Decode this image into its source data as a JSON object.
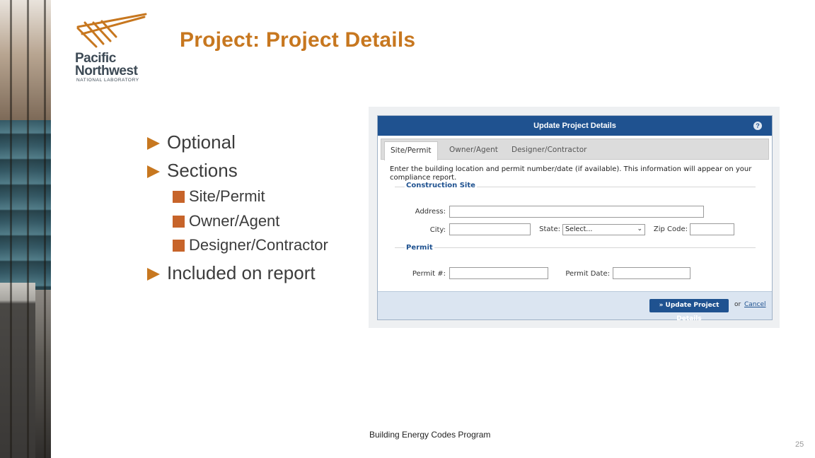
{
  "logo": {
    "line1": "Pacific",
    "line2": "Northwest",
    "line3": "NATIONAL LABORATORY"
  },
  "title": "Project: Project Details",
  "bullets": {
    "optional": "Optional",
    "sections": "Sections",
    "sub": [
      "Site/Permit",
      "Owner/Agent",
      "Designer/Contractor"
    ],
    "included": "Included on report"
  },
  "dialog": {
    "title": "Update Project Details",
    "help_icon": "?",
    "tabs": [
      "Site/Permit",
      "Owner/Agent",
      "Designer/Contractor"
    ],
    "intro": "Enter the building location and permit number/date (if available). This information will appear on your compliance report.",
    "construction_legend": "Construction Site",
    "address_label": "Address:",
    "city_label": "City:",
    "state_label": "State:",
    "state_value": "Select...",
    "zip_label": "Zip Code:",
    "permit_legend": "Permit",
    "permit_no_label": "Permit #:",
    "permit_date_label": "Permit Date:",
    "update_button": "» Update Project Details",
    "or": "or",
    "cancel": "Cancel"
  },
  "caption": "Building Energy Codes Program",
  "page_number": "25",
  "colors": {
    "accent": "#c7771f",
    "dialog_blue": "#1f5290"
  }
}
